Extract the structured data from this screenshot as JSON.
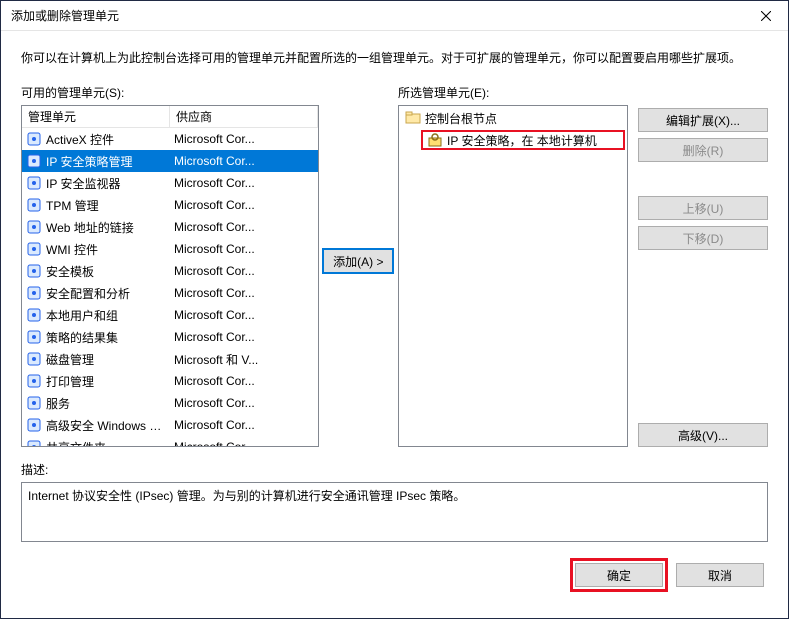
{
  "window": {
    "title": "添加或删除管理单元"
  },
  "intro": "你可以在计算机上为此控制台选择可用的管理单元并配置所选的一组管理单元。对于可扩展的管理单元，你可以配置要启用哪些扩展项。",
  "available": {
    "label": "可用的管理单元(S):",
    "columns": {
      "name": "管理单元",
      "vendor": "供应商"
    },
    "items": [
      {
        "name": "ActiveX 控件",
        "vendor": "Microsoft Cor...",
        "icon": "activex-icon"
      },
      {
        "name": "IP 安全策略管理",
        "vendor": "Microsoft Cor...",
        "icon": "ipsec-policy-icon",
        "selected": true
      },
      {
        "name": "IP 安全监视器",
        "vendor": "Microsoft Cor...",
        "icon": "ipsec-monitor-icon"
      },
      {
        "name": "TPM 管理",
        "vendor": "Microsoft Cor...",
        "icon": "tpm-icon"
      },
      {
        "name": "Web 地址的链接",
        "vendor": "Microsoft Cor...",
        "icon": "web-link-icon"
      },
      {
        "name": "WMI 控件",
        "vendor": "Microsoft Cor...",
        "icon": "wmi-icon"
      },
      {
        "name": "安全模板",
        "vendor": "Microsoft Cor...",
        "icon": "sec-template-icon"
      },
      {
        "name": "安全配置和分析",
        "vendor": "Microsoft Cor...",
        "icon": "sec-config-icon"
      },
      {
        "name": "本地用户和组",
        "vendor": "Microsoft Cor...",
        "icon": "users-groups-icon"
      },
      {
        "name": "策略的结果集",
        "vendor": "Microsoft Cor...",
        "icon": "rsop-icon"
      },
      {
        "name": "磁盘管理",
        "vendor": "Microsoft 和 V...",
        "icon": "disk-mgmt-icon"
      },
      {
        "name": "打印管理",
        "vendor": "Microsoft Cor...",
        "icon": "print-mgmt-icon"
      },
      {
        "name": "服务",
        "vendor": "Microsoft Cor...",
        "icon": "services-icon"
      },
      {
        "name": "高级安全 Windows 防...",
        "vendor": "Microsoft Cor...",
        "icon": "firewall-icon"
      },
      {
        "name": "共享文件夹",
        "vendor": "Microsoft Cor...",
        "icon": "shared-folders-icon"
      }
    ]
  },
  "selected": {
    "label": "所选管理单元(E):",
    "root": "控制台根节点",
    "child": "IP 安全策略，在 本地计算机"
  },
  "buttons": {
    "add": "添加(A) >",
    "edit_ext": "编辑扩展(X)...",
    "remove": "删除(R)",
    "move_up": "上移(U)",
    "move_down": "下移(D)",
    "advanced": "高级(V)...",
    "ok": "确定",
    "cancel": "取消"
  },
  "description": {
    "label": "描述:",
    "text": "Internet 协议安全性 (IPsec) 管理。为与别的计算机进行安全通讯管理 IPsec 策略。"
  }
}
